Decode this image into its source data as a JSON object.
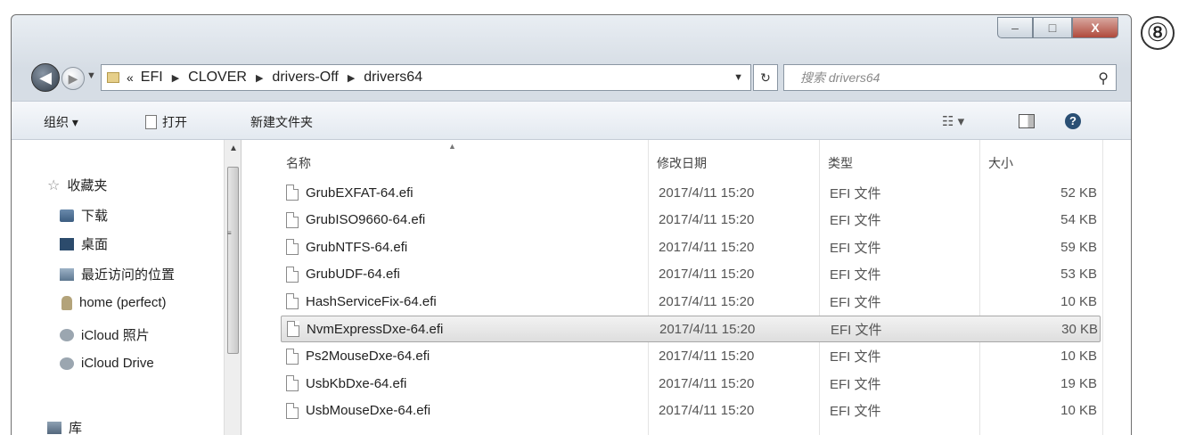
{
  "window": {
    "marker": "⑧",
    "caption": {
      "minimize": "–",
      "maximize": "□",
      "close": "X"
    }
  },
  "address_bar": {
    "lead": "«",
    "crumbs": [
      "EFI",
      "CLOVER",
      "drivers-Off",
      "drivers64"
    ],
    "search_placeholder": "搜索 drivers64"
  },
  "toolbar": {
    "organize": "组织 ▾",
    "open": "打开",
    "new_folder": "新建文件夹",
    "view": "☷ ▾"
  },
  "nav_pane": {
    "items": [
      {
        "label": "收藏夹",
        "icon": "star-icon"
      },
      {
        "label": "下载",
        "icon": "download-folder-icon"
      },
      {
        "label": "桌面",
        "icon": "desktop-icon"
      },
      {
        "label": "最近访问的位置",
        "icon": "recent-places-icon"
      },
      {
        "label": "home (perfect)",
        "icon": "user-folder-icon"
      },
      {
        "label": "iCloud 照片",
        "icon": "icloud-photos-icon"
      },
      {
        "label": "iCloud Drive",
        "icon": "icloud-drive-icon"
      },
      {
        "label": "库",
        "icon": "library-icon"
      }
    ]
  },
  "file_list": {
    "columns": {
      "name": "名称",
      "date": "修改日期",
      "type": "类型",
      "size": "大小"
    },
    "rows": [
      {
        "name": "GrubEXFAT-64.efi",
        "date": "2017/4/11 15:20",
        "type": "EFI 文件",
        "size": "52 KB",
        "selected": false
      },
      {
        "name": "GrubISO9660-64.efi",
        "date": "2017/4/11 15:20",
        "type": "EFI 文件",
        "size": "54 KB",
        "selected": false
      },
      {
        "name": "GrubNTFS-64.efi",
        "date": "2017/4/11 15:20",
        "type": "EFI 文件",
        "size": "59 KB",
        "selected": false
      },
      {
        "name": "GrubUDF-64.efi",
        "date": "2017/4/11 15:20",
        "type": "EFI 文件",
        "size": "53 KB",
        "selected": false
      },
      {
        "name": "HashServiceFix-64.efi",
        "date": "2017/4/11 15:20",
        "type": "EFI 文件",
        "size": "10 KB",
        "selected": false
      },
      {
        "name": "NvmExpressDxe-64.efi",
        "date": "2017/4/11 15:20",
        "type": "EFI 文件",
        "size": "30 KB",
        "selected": true
      },
      {
        "name": "Ps2MouseDxe-64.efi",
        "date": "2017/4/11 15:20",
        "type": "EFI 文件",
        "size": "10 KB",
        "selected": false
      },
      {
        "name": "UsbKbDxe-64.efi",
        "date": "2017/4/11 15:20",
        "type": "EFI 文件",
        "size": "19 KB",
        "selected": false
      },
      {
        "name": "UsbMouseDxe-64.efi",
        "date": "2017/4/11 15:20",
        "type": "EFI 文件",
        "size": "10 KB",
        "selected": false
      }
    ]
  }
}
